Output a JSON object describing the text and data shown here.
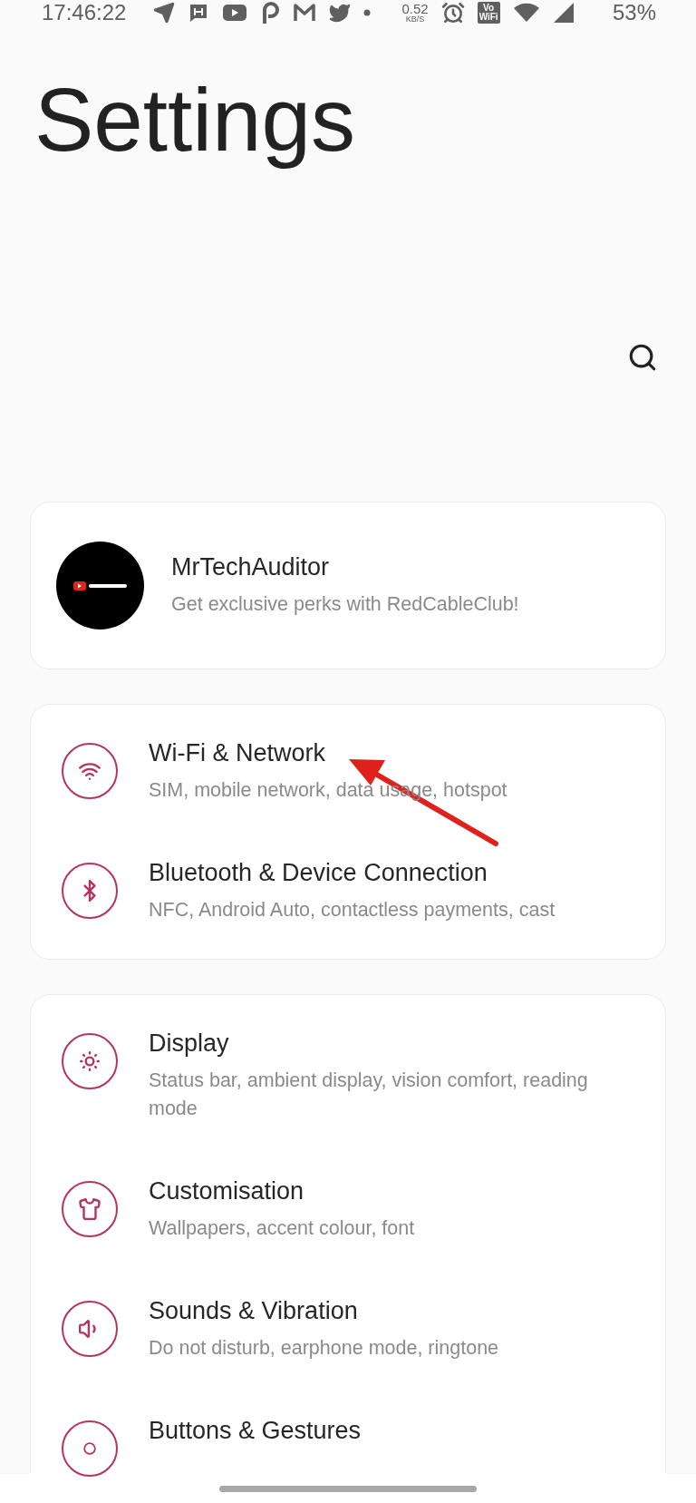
{
  "status_bar": {
    "time": "17:46:22",
    "speed": {
      "value": "0.52",
      "unit": "KB/S"
    },
    "vowifi": {
      "top": "Vo",
      "bottom": "WiFi"
    },
    "battery": "53%"
  },
  "title": "Settings",
  "profile": {
    "name": "MrTechAuditor",
    "subtitle": "Get exclusive perks with RedCableClub!"
  },
  "groups": [
    {
      "annotated": true,
      "items": [
        {
          "kind": "wifi",
          "title": "Wi-Fi & Network",
          "subtitle": "SIM, mobile network, data usage, hotspot"
        },
        {
          "kind": "bluetooth",
          "title": "Bluetooth & Device Connection",
          "subtitle": "NFC, Android Auto, contactless payments, cast"
        }
      ]
    },
    {
      "annotated": false,
      "items": [
        {
          "kind": "display",
          "title": "Display",
          "subtitle": "Status bar, ambient display, vision comfort, reading mode"
        },
        {
          "kind": "customisation",
          "title": "Customisation",
          "subtitle": "Wallpapers, accent colour, font"
        },
        {
          "kind": "sound",
          "title": "Sounds & Vibration",
          "subtitle": "Do not disturb, earphone mode, ringtone"
        },
        {
          "kind": "buttons",
          "title": "Buttons & Gestures"
        }
      ]
    }
  ]
}
